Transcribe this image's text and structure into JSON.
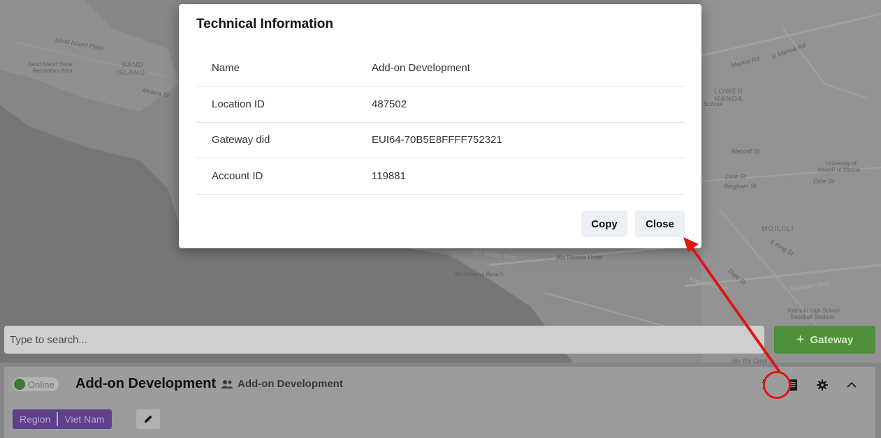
{
  "modal": {
    "title": "Technical Information",
    "rows": [
      {
        "label": "Name",
        "value": "Add-on Development"
      },
      {
        "label": "Location ID",
        "value": "487502"
      },
      {
        "label": "Gateway did",
        "value": "EUI64-70B5E8FFFF752321"
      },
      {
        "label": "Account ID",
        "value": "119881"
      }
    ],
    "copy_label": "Copy",
    "close_label": "Close"
  },
  "search": {
    "placeholder": "Type to search..."
  },
  "gateway_button": {
    "plus": "+",
    "label": "Gateway"
  },
  "gateway": {
    "status": "Online",
    "name": "Add-on Development",
    "group_name": "Add-on Development",
    "tag_key": "Region",
    "tag_value": "Viet Nam",
    "icons": [
      "info-icon",
      "document-icon",
      "gear-icon",
      "chevron-up-icon"
    ]
  },
  "map_labels": {
    "sand_island_pkwy": "Sand Island Pkwy",
    "sand_island": "SAND",
    "sand_island2": "ISLAND",
    "state_rec": "Sand Island State",
    "state_rec2": "Recreation Area",
    "mokea": "Mokea St",
    "lower_manoa": "LOWER",
    "lower_manoa2": "MANOA",
    "metcalf": "Metcalf St",
    "dole": "Dole St",
    "bingham": "Bingham St",
    "moiliili": "MOILIILI",
    "ala_moana_blvd": "Ala Moana Blvd",
    "ala_moana_hotel": "Ala Moana Hotel",
    "ala_moana_beach": "Ala Moana Beach",
    "kapiolani": "Kapiolani Blvd",
    "kapiolani2": "Kapiolani Blvd",
    "university": "University of",
    "university2": "Hawai'i at Manoa",
    "dole2": "Dole St",
    "kaimuki": "Kaimuki High School",
    "kaimuki2": "Baseball Stadium",
    "manoa_rd": "Manoa Rd",
    "e_manoa": "E Manoa Rd",
    "ala_wai": "Ala Wai Canal",
    "school": "School",
    "date": "Date St",
    "king": "S King St"
  },
  "colors": {
    "accent_green": "#4e8f3a",
    "tag_purple": "#5d3f8c",
    "annotation_red": "#e01515"
  }
}
